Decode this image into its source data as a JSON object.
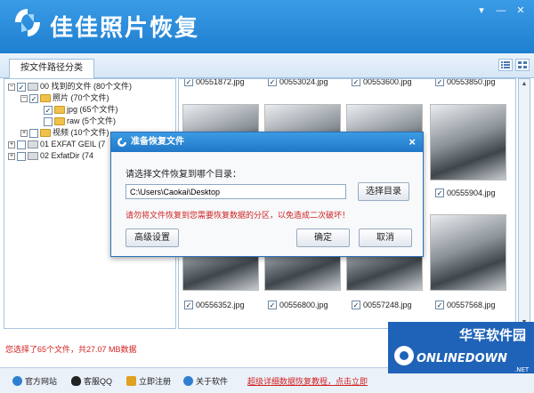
{
  "app": {
    "title": "佳佳照片恢复",
    "window_buttons": [
      "▾",
      "—",
      "✕"
    ]
  },
  "tab": {
    "label": "按文件路径分类"
  },
  "tree": [
    {
      "label": "00  找到的文件   (80个文件)",
      "indent": 0,
      "expander": "−",
      "checked": "✓",
      "icon": "drive"
    },
    {
      "label": "照片   (70个文件)",
      "indent": 1,
      "expander": "−",
      "checked": "✓",
      "icon": "folder"
    },
    {
      "label": "jpg    (65个文件)",
      "indent": 2,
      "expander": "",
      "checked": "✓",
      "icon": "folder"
    },
    {
      "label": "raw    (5个文件)",
      "indent": 2,
      "expander": "",
      "checked": "",
      "icon": "folder"
    },
    {
      "label": "视频   (10个文件)",
      "indent": 1,
      "expander": "+",
      "checked": "",
      "icon": "folder"
    },
    {
      "label": "01  EXFAT GEIL    (7",
      "indent": 0,
      "expander": "+",
      "checked": "",
      "icon": "drive"
    },
    {
      "label": "02  ExfatDir    (74",
      "indent": 0,
      "expander": "+",
      "checked": "",
      "icon": "drive"
    }
  ],
  "thumbnails": {
    "top_row": [
      "00551872.jpg",
      "00553024.jpg",
      "00553600.jpg",
      "00553850.jpg"
    ],
    "visible_mid": [
      "00555904.jpg"
    ],
    "bottom_row": [
      "00556352.jpg",
      "00556800.jpg",
      "00557248.jpg",
      "00557568.jpg"
    ]
  },
  "dialog": {
    "title": "准备恢复文件",
    "close": "×",
    "prompt": "请选择文件恢复到哪个目录：",
    "path_value": "C:\\Users\\Caokai\\Desktop",
    "browse_label": "选择目录",
    "warning": "请勿将文件恢复到您需要恢复数据的分区，以免造成二次破坏！",
    "advanced_label": "高级设置",
    "ok_label": "确定",
    "cancel_label": "取消"
  },
  "status": {
    "text": "您选择了65个文件，共27.07 MB数据"
  },
  "footer": {
    "links": [
      {
        "label": "官方网站",
        "icon": "globe-icon",
        "color": "#2f7fd0"
      },
      {
        "label": "客服QQ",
        "icon": "qq-penguin-icon",
        "color": "#222222"
      },
      {
        "label": "立即注册",
        "icon": "key-icon",
        "color": "#e0a020"
      },
      {
        "label": "关于软件",
        "icon": "info-icon",
        "color": "#2f7fd0"
      }
    ],
    "promo": "超级详细数据恢复教程，点击立即"
  },
  "watermark": {
    "line1": "华军软件园",
    "line2": "ONLINEDOWN",
    "suffix": ".NET"
  },
  "colors": {
    "title_bar": "#2a8ad8",
    "warning": "#d12222",
    "accent": "#2c6fb6"
  }
}
